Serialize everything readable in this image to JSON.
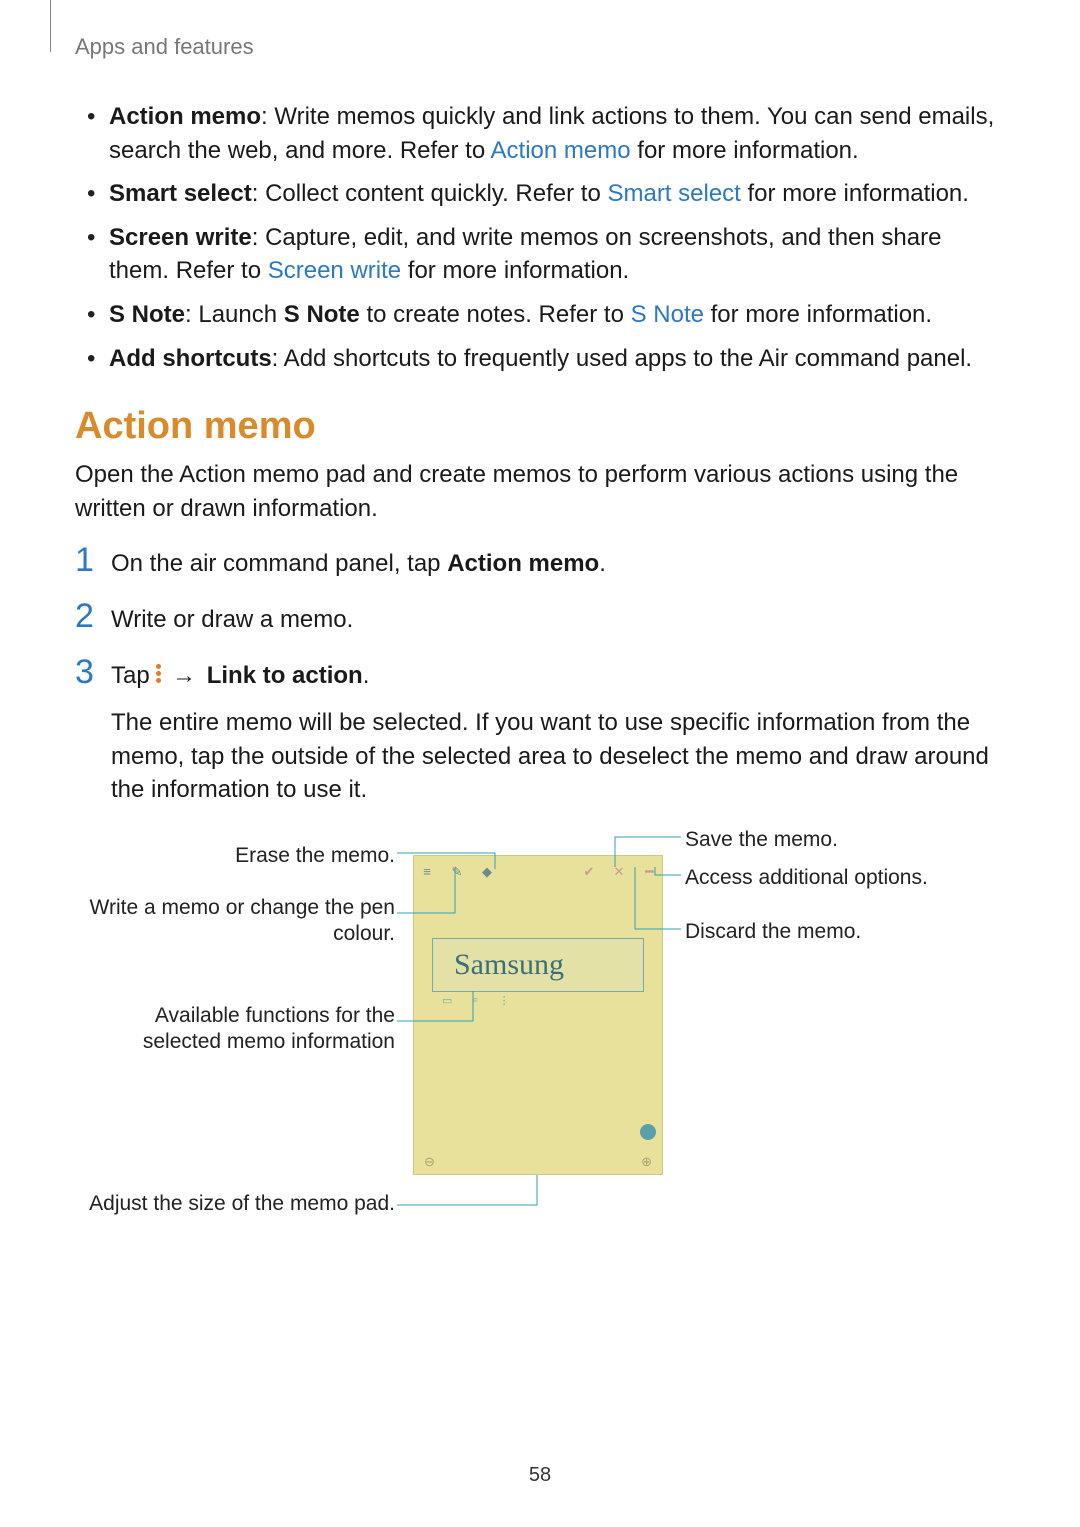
{
  "breadcrumb": "Apps and features",
  "features": [
    {
      "term": "Action memo",
      "before": ": Write memos quickly and link actions to them. You can send emails, search the web, and more. Refer to ",
      "link": "Action memo",
      "after": " for more information."
    },
    {
      "term": "Smart select",
      "before": ": Collect content quickly. Refer to ",
      "link": "Smart select",
      "after": " for more information."
    },
    {
      "term": "Screen write",
      "before": ": Capture, edit, and write memos on screenshots, and then share them. Refer to ",
      "link": "Screen write",
      "after": " for more information."
    },
    {
      "term": "S Note",
      "before": ": Launch ",
      "mid_bold": "S Note",
      "mid_after": " to create notes. Refer to ",
      "link": "S Note",
      "after": " for more information."
    },
    {
      "term": "Add shortcuts",
      "before": ": Add shortcuts to frequently used apps to the Air command panel.",
      "link": "",
      "after": ""
    }
  ],
  "section_heading": "Action memo",
  "section_intro": "Open the Action memo pad and create memos to perform various actions using the written or drawn information.",
  "steps": {
    "s1_prefix": "On the air command panel, tap ",
    "s1_bold": "Action memo",
    "s1_suffix": ".",
    "s2": "Write or draw a memo.",
    "s3_prefix": "Tap ",
    "s3_arrow": "→",
    "s3_bold": "Link to action",
    "s3_suffix": ".",
    "s3_body": "The entire memo will be selected. If you want to use specific information from the memo, tap the outside of the selected area to deselect the memo and draw around the information to use it."
  },
  "diagram": {
    "handwriting": "Samsung",
    "callouts": {
      "erase": "Erase the memo.",
      "pen": "Write a memo or change the pen colour.",
      "functions": "Available functions for the selected memo information",
      "resize": "Adjust the size of the memo pad.",
      "save": "Save the memo.",
      "more": "Access additional options.",
      "discard": "Discard the memo."
    }
  },
  "page_number": "58"
}
